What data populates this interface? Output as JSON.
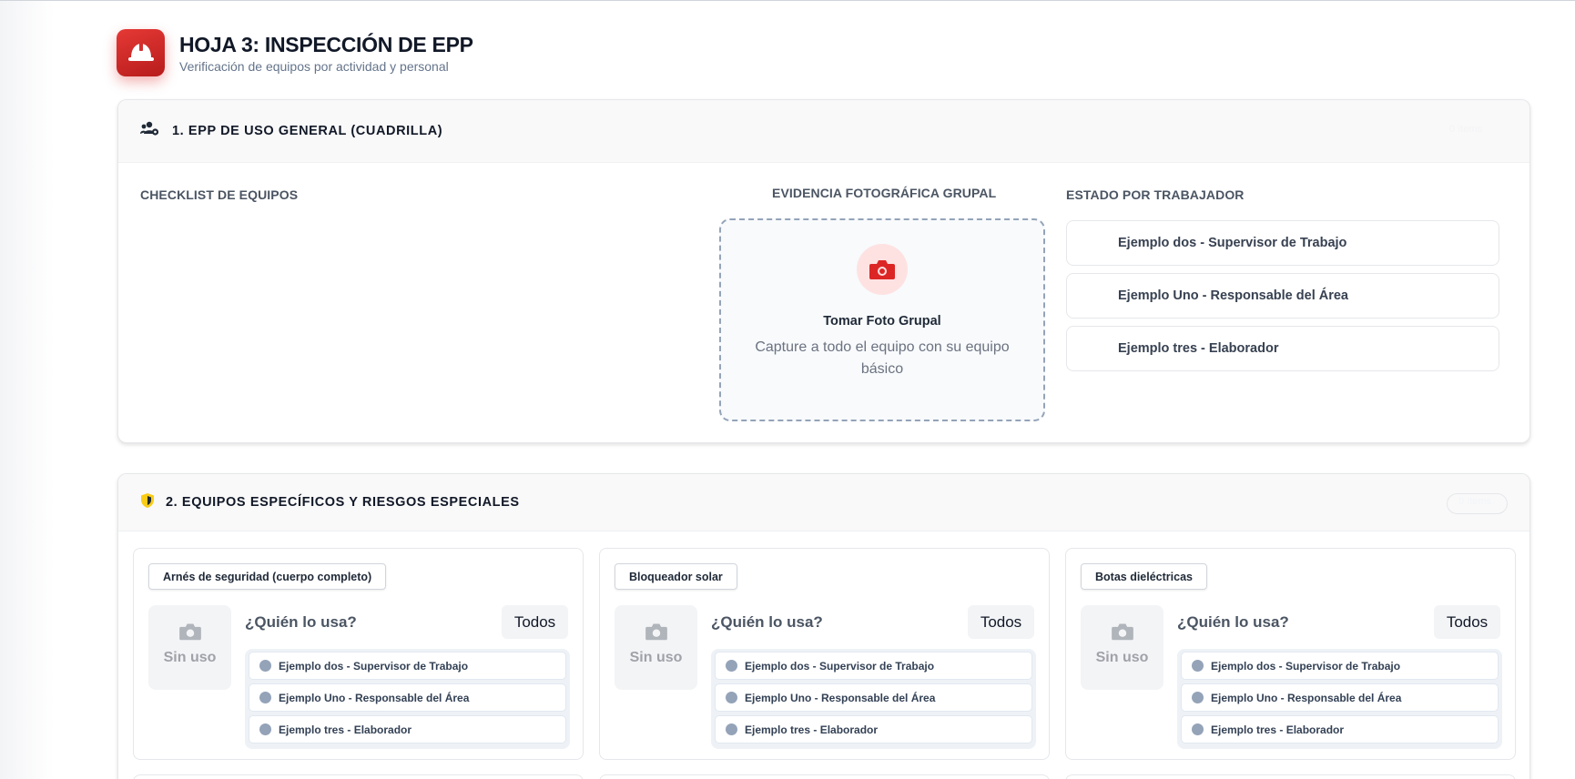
{
  "header": {
    "title": "HOJA 3: INSPECCIÓN DE EPP",
    "subtitle": "Verificación de equipos por actividad y personal",
    "icon": "helmet-icon",
    "accent_color": "#d32f2f"
  },
  "section1": {
    "title": "1. EPP DE USO GENERAL (CUADRILLA)",
    "icon": "group-users-icon",
    "badge": "0 ítems",
    "checklist_label": "CHECKLIST DE EQUIPOS",
    "photo_label": "EVIDENCIA FOTOGRÁFICA GRUPAL",
    "photo_title": "Tomar Foto Grupal",
    "photo_desc": "Capture a todo el equipo con su equipo básico",
    "workers_label": "ESTADO POR TRABAJADOR",
    "workers": [
      "Ejemplo dos - Supervisor de Trabajo",
      "Ejemplo Uno - Responsable del Área",
      "Ejemplo tres - Elaborador"
    ]
  },
  "section2": {
    "title": "2. EQUIPOS ESPECÍFICOS Y RIESGOS ESPECIALES",
    "icon": "shield-icon",
    "badge": "0 ítems",
    "cards": [
      {
        "tag": "Arnés de seguridad (cuerpo completo)",
        "slot_label": "Sin uso",
        "question": "¿Quién lo usa?",
        "all_label": "Todos",
        "people": [
          "Ejemplo dos - Supervisor de Trabajo",
          "Ejemplo Uno - Responsable del Área",
          "Ejemplo tres - Elaborador"
        ]
      },
      {
        "tag": "Bloqueador solar",
        "slot_label": "Sin uso",
        "question": "¿Quién lo usa?",
        "all_label": "Todos",
        "people": [
          "Ejemplo dos - Supervisor de Trabajo",
          "Ejemplo Uno - Responsable del Área",
          "Ejemplo tres - Elaborador"
        ]
      },
      {
        "tag": "Botas dieléctricas",
        "slot_label": "Sin uso",
        "question": "¿Quién lo usa?",
        "all_label": "Todos",
        "people": [
          "Ejemplo dos - Supervisor de Trabajo",
          "Ejemplo Uno - Responsable del Área",
          "Ejemplo tres - Elaborador"
        ]
      }
    ]
  }
}
